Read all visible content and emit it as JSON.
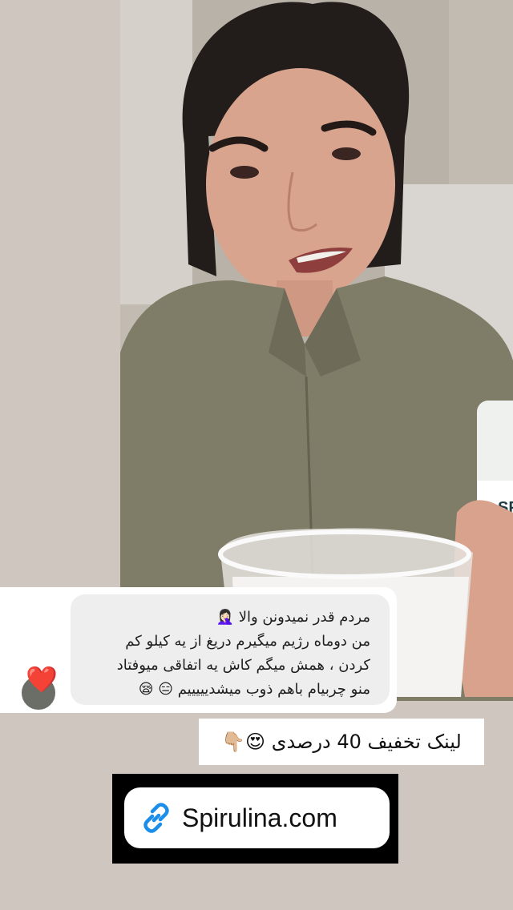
{
  "comment": {
    "lines": [
      "مردم قدر نمیدونن والا 🤦🏻‍♀️",
      "من دوماه رژیم میگیرم دریغ از یه کیلو کم",
      "کردن ، همش میگم کاش یه اتفاقی میوفتاد",
      "منو چربیام باهم ذوب میشدیییییم 😑 😪"
    ],
    "reaction": "❤️"
  },
  "discount_text": "لینک تخفیف 40 درصدی 😍👇🏼",
  "link": {
    "label": "Spirulina.com",
    "icon": "link-icon"
  },
  "bottle_label": "SP"
}
